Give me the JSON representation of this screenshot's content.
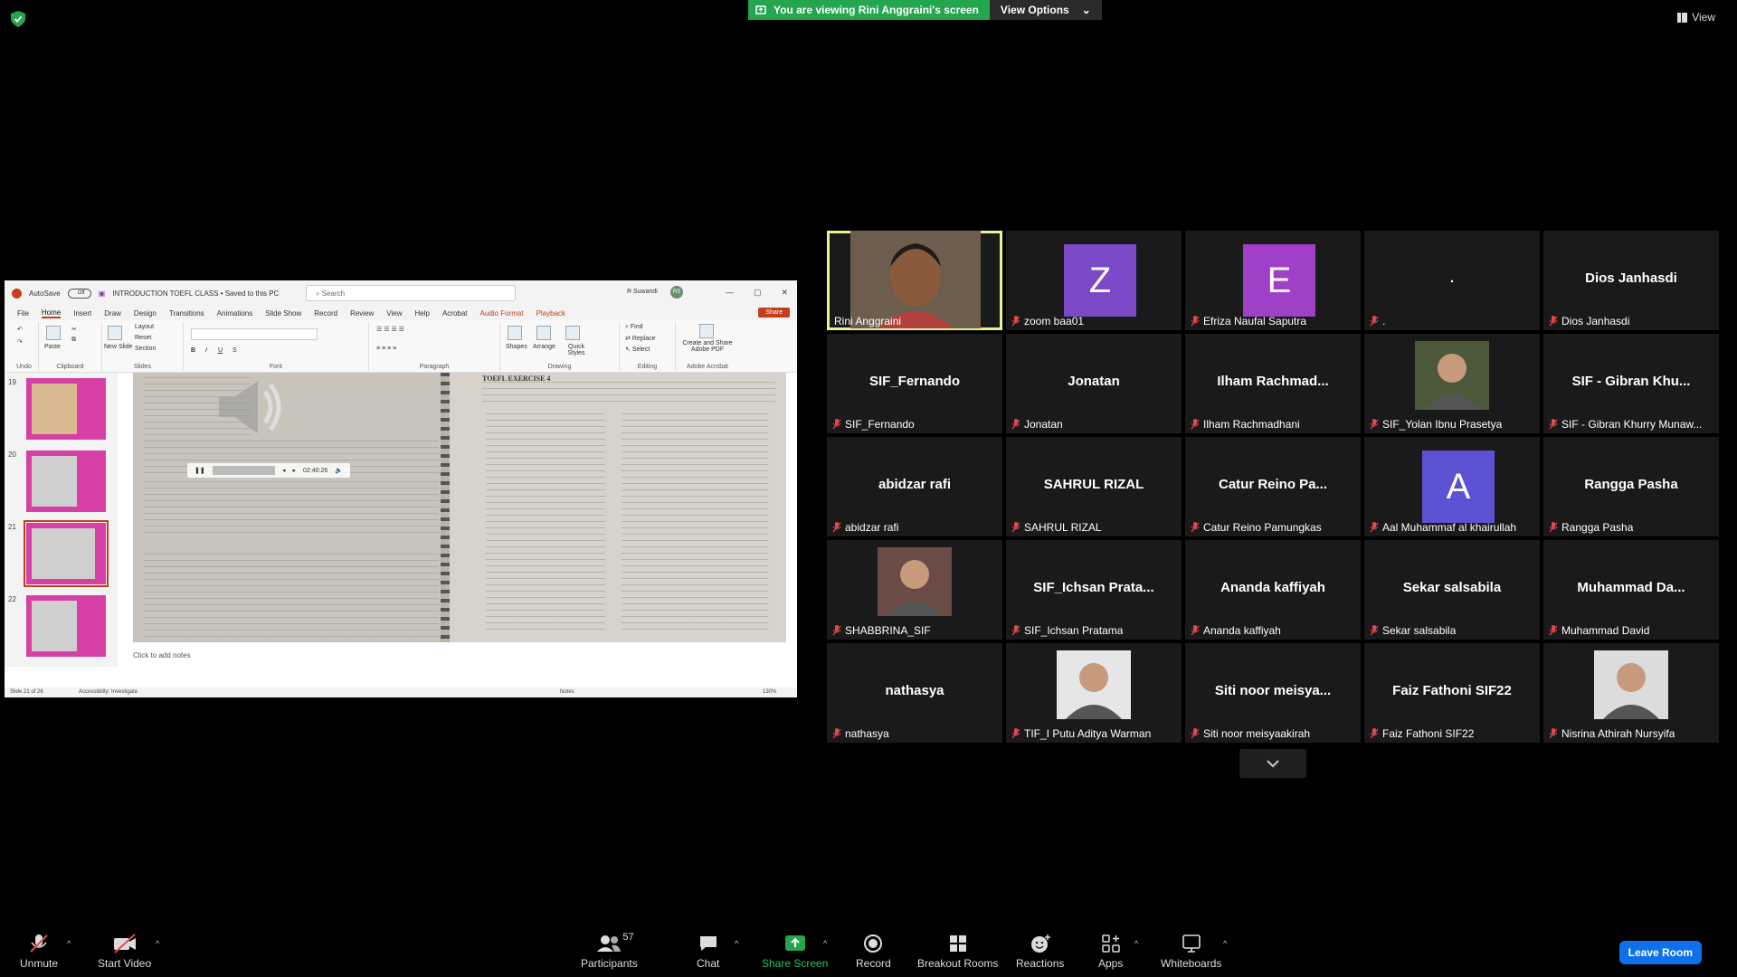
{
  "topbar": {
    "viewing_text": "You are viewing Rini Anggraini's screen",
    "view_options": "View Options",
    "view_label": "View"
  },
  "powerpoint": {
    "autosave": "AutoSave",
    "toggle": "Off",
    "doc_title": "INTRODUCTION TOEFL CLASS • Saved to this PC",
    "search_placeholder": "Search",
    "user": "R Suwandi",
    "user_initials": "RS",
    "menu": [
      "File",
      "Home",
      "Insert",
      "Draw",
      "Design",
      "Transitions",
      "Animations",
      "Slide Show",
      "Record",
      "Review",
      "View",
      "Help",
      "Acrobat",
      "Audio Format",
      "Playback"
    ],
    "share": "Share",
    "ribbon_groups": [
      "Undo",
      "Clipboard",
      "Slides",
      "Font",
      "Paragraph",
      "Drawing",
      "Editing",
      "Adobe Acrobat"
    ],
    "ribbon_items": {
      "paste": "Paste",
      "new_slide": "New Slide",
      "layout": "Layout",
      "reset": "Reset",
      "section": "Section",
      "shapes": "Shapes",
      "arrange": "Arrange",
      "quick_styles": "Quick Styles",
      "find": "Find",
      "replace": "Replace",
      "select": "Select",
      "adobe": "Create and Share Adobe PDF"
    },
    "thumbs": [
      "19",
      "20",
      "21",
      "22"
    ],
    "exercise_title": "TOEFL EXERCISE 4",
    "player_time": "02:40:26",
    "notes_placeholder": "Click to add notes",
    "status_slide": "Slide 21 of 26",
    "status_accessibility": "Accessibility: Investigate",
    "status_notes": "Notes",
    "zoom": "130%"
  },
  "participants": [
    {
      "name": "Rini Anggraini",
      "label": "Rini Anggraini",
      "type": "video",
      "active": true
    },
    {
      "name": "zoom baa01",
      "label": "zoom baa01",
      "type": "avatar",
      "letter": "Z",
      "color": "#7b48c8"
    },
    {
      "name": "Efriza Naufal Saputra",
      "label": "Efriza Naufal Saputra",
      "type": "avatar",
      "letter": "E",
      "color": "#a03fc7"
    },
    {
      "name": ".",
      "label": ".",
      "type": "name"
    },
    {
      "name": "Dios Janhasdi",
      "label": "Dios Janhasdi",
      "type": "name"
    },
    {
      "name": "SIF_Fernando",
      "label": "SIF_Fernando",
      "type": "name"
    },
    {
      "name": "Jonatan",
      "label": "Jonatan",
      "type": "name"
    },
    {
      "name": "Ilham  Rachmad...",
      "label": "Ilham Rachmadhani",
      "type": "name"
    },
    {
      "name": "SIF_Yolan Ibnu Prasetya",
      "label": "SIF_Yolan Ibnu Prasetya",
      "type": "photo",
      "color": "#4c5a3b"
    },
    {
      "name": "SIF - Gibran Khu...",
      "label": "SIF - Gibran Khurry Munaw...",
      "type": "name"
    },
    {
      "name": "abidzar rafi",
      "label": "abidzar rafi",
      "type": "name"
    },
    {
      "name": "SAHRUL RIZAL",
      "label": "SAHRUL RIZAL",
      "type": "name"
    },
    {
      "name": "Catur Reino Pa...",
      "label": "Catur Reino Pamungkas",
      "type": "name"
    },
    {
      "name": "Aal Muhammaf al khairullah",
      "label": "Aal Muhammaf al khairullah",
      "type": "avatar",
      "letter": "A",
      "color": "#5b52d4"
    },
    {
      "name": "Rangga Pasha",
      "label": "Rangga Pasha",
      "type": "name"
    },
    {
      "name": "SHABBRINA_SIF",
      "label": "SHABBRINA_SIF",
      "type": "photo",
      "color": "#6b4b45"
    },
    {
      "name": "SIF_Ichsan  Prata...",
      "label": "SIF_Ichsan Pratama",
      "type": "name"
    },
    {
      "name": "Ananda kaffiyah",
      "label": "Ananda kaffiyah",
      "type": "name"
    },
    {
      "name": "Sekar salsabila",
      "label": "Sekar salsabila",
      "type": "name"
    },
    {
      "name": "Muhammad  Da...",
      "label": "Muhammad David",
      "type": "name"
    },
    {
      "name": "nathasya",
      "label": "nathasya",
      "type": "name"
    },
    {
      "name": "TIF_I Putu Aditya Warman",
      "label": "TIF_I Putu Aditya Warman",
      "type": "photo",
      "color": "#e6e6e6"
    },
    {
      "name": "Siti  noor  meisya...",
      "label": "Siti noor meisyaakirah",
      "type": "name"
    },
    {
      "name": "Faiz Fathoni SIF22",
      "label": "Faiz Fathoni SIF22",
      "type": "name"
    },
    {
      "name": "Nisrina Athirah Nursyifa",
      "label": "Nisrina Athirah Nursyifa",
      "type": "photo",
      "color": "#dcdcdc"
    }
  ],
  "toolbar": {
    "unmute": "Unmute",
    "start_video": "Start Video",
    "participants": "Participants",
    "participants_count": "57",
    "chat": "Chat",
    "share_screen": "Share Screen",
    "record": "Record",
    "breakout": "Breakout Rooms",
    "reactions": "Reactions",
    "apps": "Apps",
    "whiteboards": "Whiteboards",
    "leave": "Leave Room"
  },
  "colors": {
    "share_green": "#23a64e",
    "active_speaker": "#e7f28a",
    "leave_blue": "#0e71eb",
    "mute_red": "#e5484d"
  }
}
